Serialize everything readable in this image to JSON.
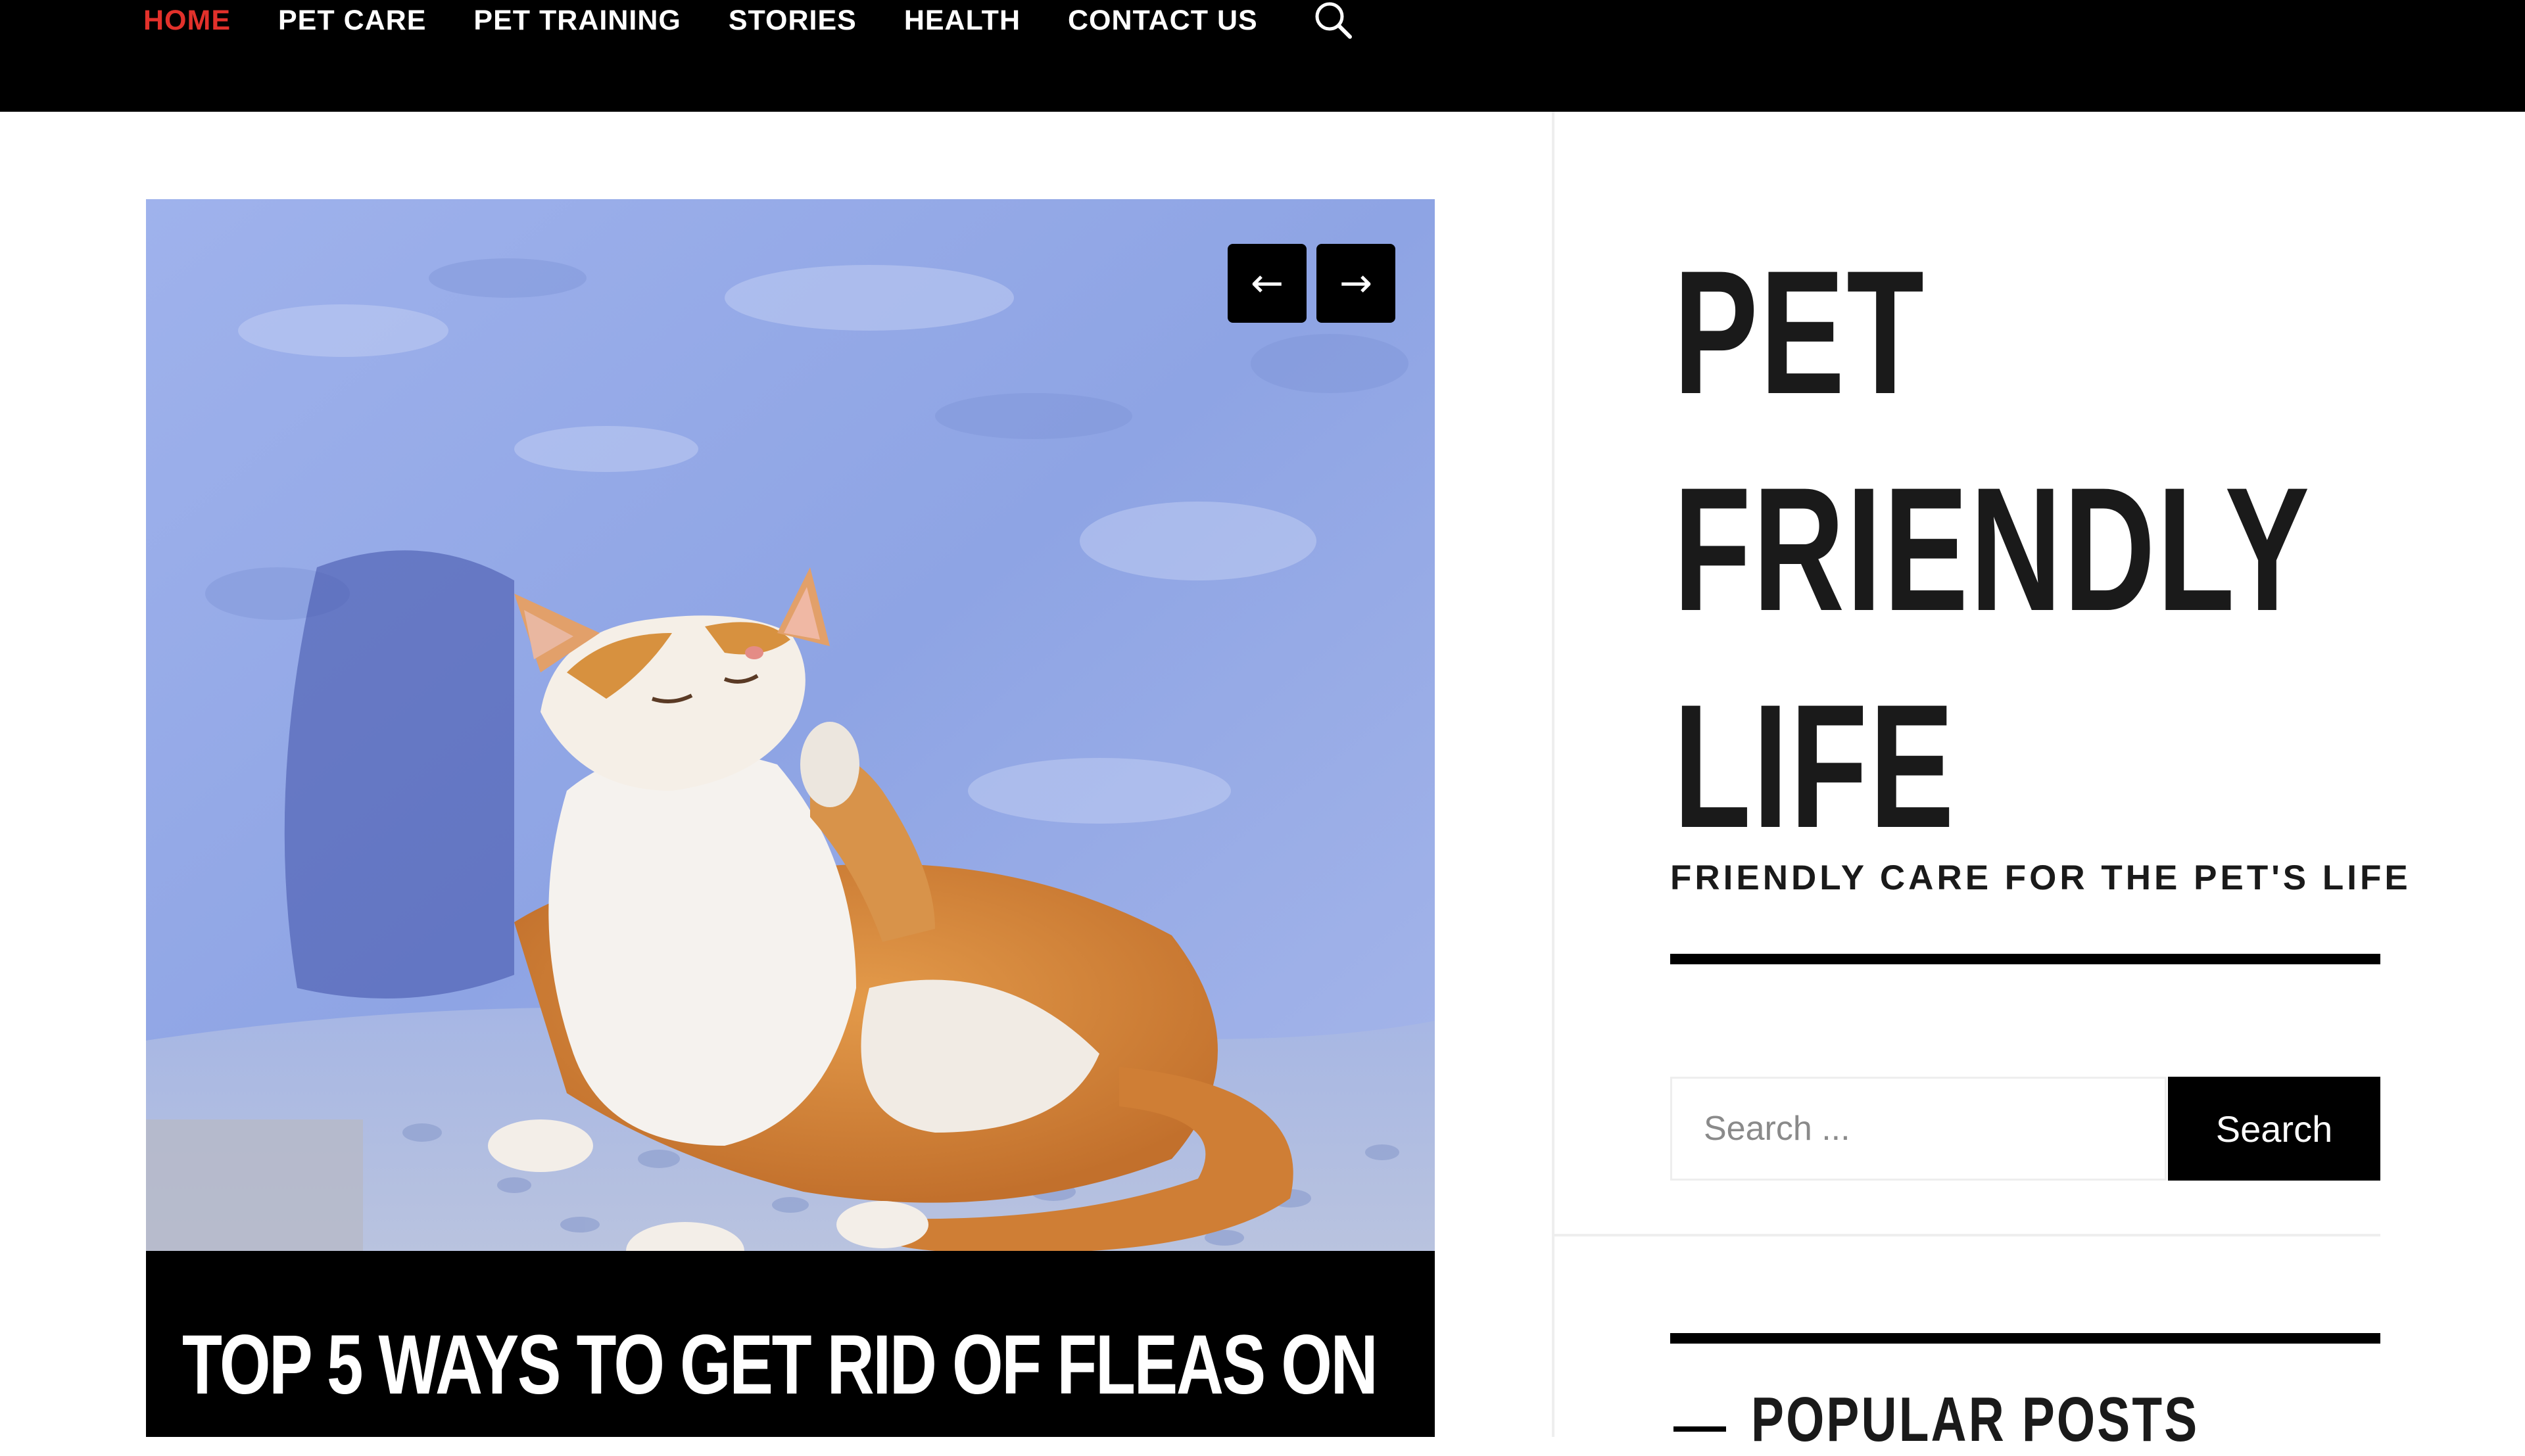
{
  "nav": {
    "items": [
      {
        "label": "HOME",
        "active": true
      },
      {
        "label": "PET CARE",
        "active": false
      },
      {
        "label": "PET TRAINING",
        "active": false
      },
      {
        "label": "STORIES",
        "active": false
      },
      {
        "label": "HEALTH",
        "active": false
      },
      {
        "label": "CONTACT US",
        "active": false
      }
    ],
    "search_icon": "search-icon",
    "active_color": "#e2312b"
  },
  "slider": {
    "image_subject": "orange and white cat scratching against a blue wall",
    "prev_icon": "arrow-left-icon",
    "next_icon": "arrow-right-icon",
    "prev_glyph": "←",
    "next_glyph": "→",
    "post_title": "TOP 5 WAYS TO GET RID OF FLEAS ON"
  },
  "sidebar": {
    "site_title_lines": [
      "PET",
      "FRIENDLY",
      "LIFE"
    ],
    "tagline": "FRIENDLY CARE FOR THE PET'S LIFE",
    "search": {
      "placeholder": "Search ...",
      "value": "",
      "button_label": "Search"
    },
    "widget_title": "POPULAR POSTS"
  },
  "colors": {
    "nav_background": "#000000",
    "accent": "#e2312b",
    "text": "#1a1a1a",
    "wall_blue": "#8fa6e4"
  }
}
